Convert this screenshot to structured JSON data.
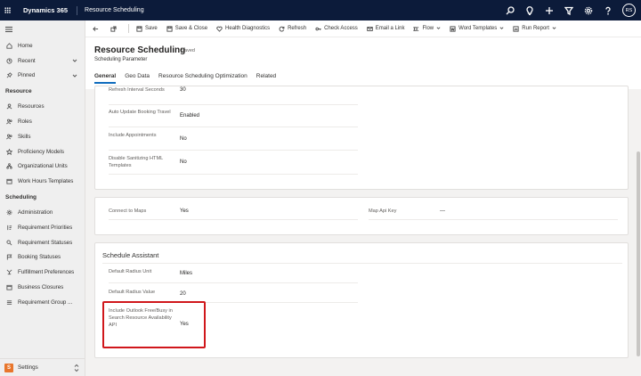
{
  "topbar": {
    "brand": "Dynamics 365",
    "app_name": "Resource Scheduling",
    "avatar_initials": "RS",
    "icons": [
      "search-icon",
      "lightbulb-icon",
      "plus-icon",
      "filter-icon",
      "gear-icon",
      "help-icon"
    ]
  },
  "sidebar": {
    "top_items": [
      {
        "label": "Home",
        "icon": "home-icon"
      },
      {
        "label": "Recent",
        "icon": "clock-icon"
      },
      {
        "label": "Pinned",
        "icon": "pin-icon"
      }
    ],
    "resource_section": "Resource",
    "resource_items": [
      {
        "label": "Resources",
        "icon": "person-icon"
      },
      {
        "label": "Roles",
        "icon": "people-icon"
      },
      {
        "label": "Skills",
        "icon": "people-icon"
      },
      {
        "label": "Proficiency Models",
        "icon": "star-icon"
      },
      {
        "label": "Organizational Units",
        "icon": "org-icon"
      },
      {
        "label": "Work Hours Templates",
        "icon": "calendar-icon"
      }
    ],
    "scheduling_section": "Scheduling",
    "scheduling_items": [
      {
        "label": "Administration",
        "icon": "gear-icon"
      },
      {
        "label": "Requirement Priorities",
        "icon": "priority-icon"
      },
      {
        "label": "Requirement Statuses",
        "icon": "status-icon"
      },
      {
        "label": "Booking Statuses",
        "icon": "flag-icon"
      },
      {
        "label": "Fulfillment Preferences",
        "icon": "preferences-icon"
      },
      {
        "label": "Business Closures",
        "icon": "calendar-icon"
      },
      {
        "label": "Requirement Group ...",
        "icon": "list-icon"
      }
    ],
    "area_badge": "S",
    "area_label": "Settings"
  },
  "commandbar": {
    "save": "Save",
    "save_close": "Save & Close",
    "health": "Health Diagnostics",
    "refresh": "Refresh",
    "check_access": "Check Access",
    "email_link": "Email a Link",
    "flow": "Flow",
    "word_templates": "Word Templates",
    "run_report": "Run Report"
  },
  "record": {
    "title": "Resource Scheduling",
    "saved": "- Saved",
    "entity": "Scheduling Parameter",
    "tabs": [
      "General",
      "Geo Data",
      "Resource Scheduling Optimization",
      "Related"
    ]
  },
  "section1": {
    "rows": [
      {
        "label": "Refresh Interval Seconds",
        "value": "30"
      },
      {
        "label": "Auto Update Booking Travel",
        "value": "Enabled"
      },
      {
        "label": "Include Appointments",
        "value": "No"
      },
      {
        "label": "Disable Sanitizing HTML Templates",
        "value": "No"
      }
    ]
  },
  "section2": {
    "connect_label": "Connect to Maps",
    "connect_value": "Yes",
    "apikey_label": "Map Api Key",
    "apikey_value": "---"
  },
  "section3": {
    "title": "Schedule Assistant",
    "rows": [
      {
        "label": "Default Radius Unit",
        "value": "Miles"
      },
      {
        "label": "Default Radius Value",
        "value": "20"
      },
      {
        "label": "Include Outlook Free/Busy in Search Resource Availability API",
        "value": "Yes"
      }
    ]
  },
  "colors": {
    "topbar": "#0c1b3a",
    "accent": "#0f6cbd",
    "highlight": "#d0171b",
    "area_badge": "#e8762c"
  }
}
